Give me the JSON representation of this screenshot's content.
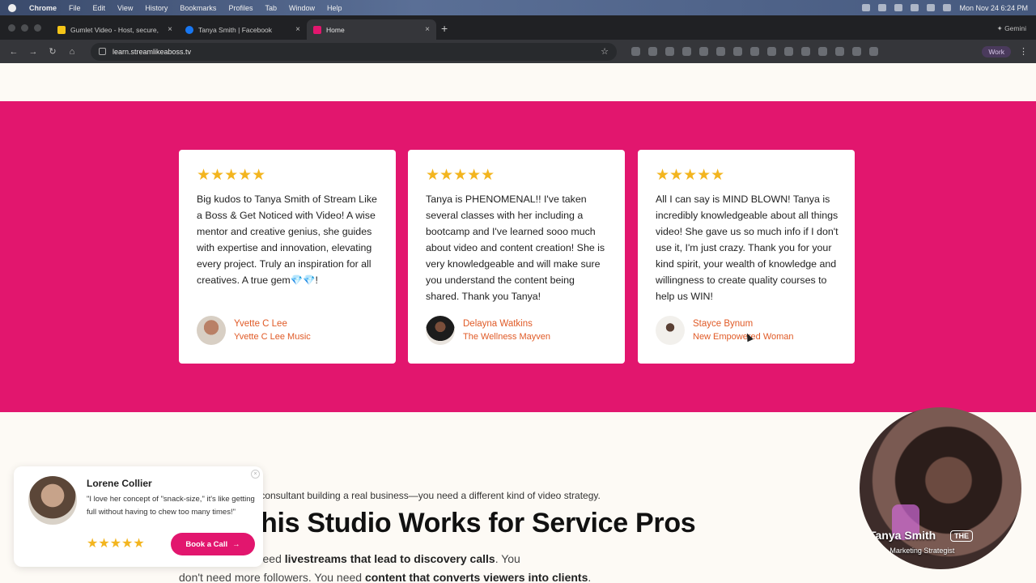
{
  "menubar": {
    "app": "Chrome",
    "items": [
      "File",
      "Edit",
      "View",
      "History",
      "Bookmarks",
      "Profiles",
      "Tab",
      "Window",
      "Help"
    ],
    "clock": "Mon Nov 24  6:24 PM"
  },
  "tabs": [
    {
      "title": "Gumlet Video - Host, secure,",
      "favicon_color": "#f5c518"
    },
    {
      "title": "Tanya Smith | Facebook",
      "favicon_color": "#1877f2"
    },
    {
      "title": "Home",
      "favicon_color": "#e2166e"
    }
  ],
  "gemini_label": "Gemini",
  "address": {
    "url": "learn.streamlikeaboss.tv"
  },
  "profile_chip": "Work",
  "testimonials": [
    {
      "stars": "★★★★★",
      "quote": "Big kudos to Tanya Smith of Stream Like a Boss & Get Noticed with Video! A wise mentor and creative genius, she guides with expertise and innovation, elevating every project. Truly an inspiration for all creatives. A true gem💎💎!",
      "name": "Yvette C Lee",
      "org": "Yvette C Lee Music"
    },
    {
      "stars": "★★★★★",
      "quote": "Tanya is PHENOMENAL!! I've taken several classes with her including a bootcamp and I've learned sooo much about video and content creation! She is very knowledgeable and will make sure you understand the content being shared. Thank you Tanya!",
      "name": "Delayna Watkins",
      "org": "The Wellness Mayven"
    },
    {
      "stars": "★★★★★",
      "quote": "All I can say is MIND BLOWN! Tanya is incredibly knowledgeable about all things video! She gave us so much info  if I don't use it, I'm just crazy. Thank you for your kind spirit, your wealth of knowledge and willingness to create quality courses to help us WIN!",
      "name": "Stayce Bynum",
      "org": "New Empowered Woman"
    }
  ],
  "section": {
    "subline": "r consultant building a real business—you need a different kind of video strategy.",
    "headline": "his Studio Works for Service Pros",
    "para_1a": "to go viral. You need ",
    "para_1b": "livestreams that lead to discovery calls",
    "para_1c": ". You",
    "para_2a": "don't need more followers. You need ",
    "para_2b": "content that converts viewers into clients",
    "para_2c": "."
  },
  "popup": {
    "name": "Lorene Collier",
    "quote": "\"I love her concept of \"snack-size,\" it's like getting full without having to chew too many times!\"",
    "stars": "★★★★★",
    "button": "Book a Call",
    "button_arrow": "→"
  },
  "presenter": {
    "name": "Tanya Smith",
    "role": "Video Marketing Strategist",
    "logo": "THE"
  },
  "colors": {
    "brand_pink": "#e2166e",
    "star_gold": "#f3b51f",
    "author_orange": "#e05a26"
  }
}
